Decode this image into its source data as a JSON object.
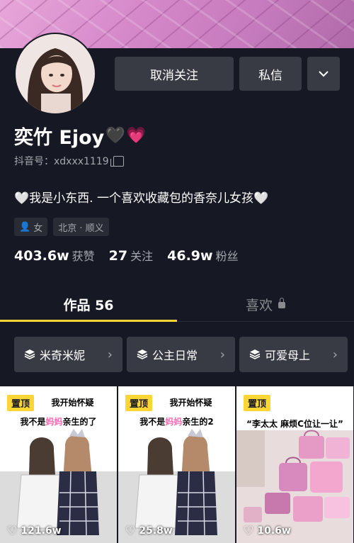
{
  "profile": {
    "display_name": "奕竹 Ejoy",
    "name_emojis": [
      "🖤",
      "💗"
    ],
    "douyin_id": "抖音号：xdxxx1119",
    "bio": "🤍我是小东西. 一个喜欢收藏包的香奈儿女孩🤍",
    "tags": {
      "gender": "女",
      "location": "北京 · 顺义"
    },
    "stats": [
      {
        "value": "403.6w",
        "label": "获赞"
      },
      {
        "value": "27",
        "label": "关注"
      },
      {
        "value": "46.9w",
        "label": "粉丝"
      }
    ]
  },
  "actions": {
    "unfollow": "取消关注",
    "message": "私信",
    "more_icon": "chevron-down-icon"
  },
  "tabs": {
    "works": "作品 56",
    "likes": "喜欢"
  },
  "collections": [
    {
      "label": "米奇米妮",
      "icon": "stack-icon"
    },
    {
      "label": "公主日常",
      "icon": "stack-icon"
    },
    {
      "label": "可爱母上",
      "icon": "stack-icon"
    }
  ],
  "videos": [
    {
      "pinned_label": "置顶",
      "caption_top": "我开始怀疑",
      "caption_a": "我不是",
      "caption_pink": "妈妈",
      "caption_b": "亲生的了",
      "likes": "121.6w"
    },
    {
      "pinned_label": "置顶",
      "caption_top": "我开始怀疑",
      "caption_a": "我不是",
      "caption_pink": "妈妈",
      "caption_b": "亲生的2",
      "likes": "25.8w"
    },
    {
      "pinned_label": "置顶",
      "caption": "“李太太 麻烦C位让一让”",
      "likes": "10.6w"
    }
  ],
  "colors": {
    "background": "#161823",
    "button": "#393b44",
    "accent_yellow": "#fdd535",
    "muted_text": "#a5a7ad"
  }
}
